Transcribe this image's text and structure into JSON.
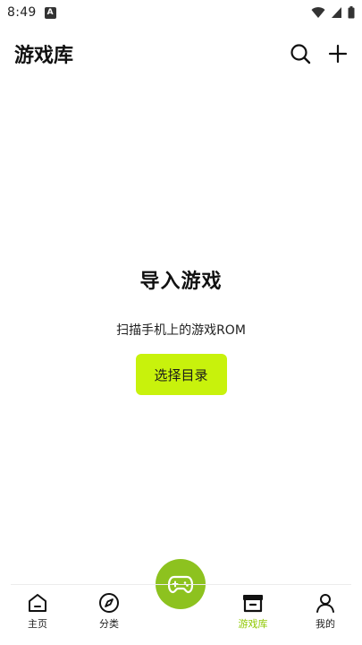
{
  "status_bar": {
    "time": "8:49",
    "app_icon": "A"
  },
  "header": {
    "title": "游戏库"
  },
  "empty_state": {
    "title": "导入游戏",
    "description": "扫描手机上的游戏ROM",
    "button_label": "选择目录"
  },
  "bottom_nav": {
    "items": [
      {
        "label": "主页",
        "icon": "home-icon"
      },
      {
        "label": "分类",
        "icon": "compass-icon"
      },
      {
        "label": "游戏库",
        "icon": "archive-icon",
        "active": true
      },
      {
        "label": "我的",
        "icon": "user-icon"
      }
    ],
    "fab_icon": "gamepad-icon"
  },
  "colors": {
    "accent": "#c8f20c",
    "fab": "#8dc21f",
    "active_label": "#8fc800"
  }
}
